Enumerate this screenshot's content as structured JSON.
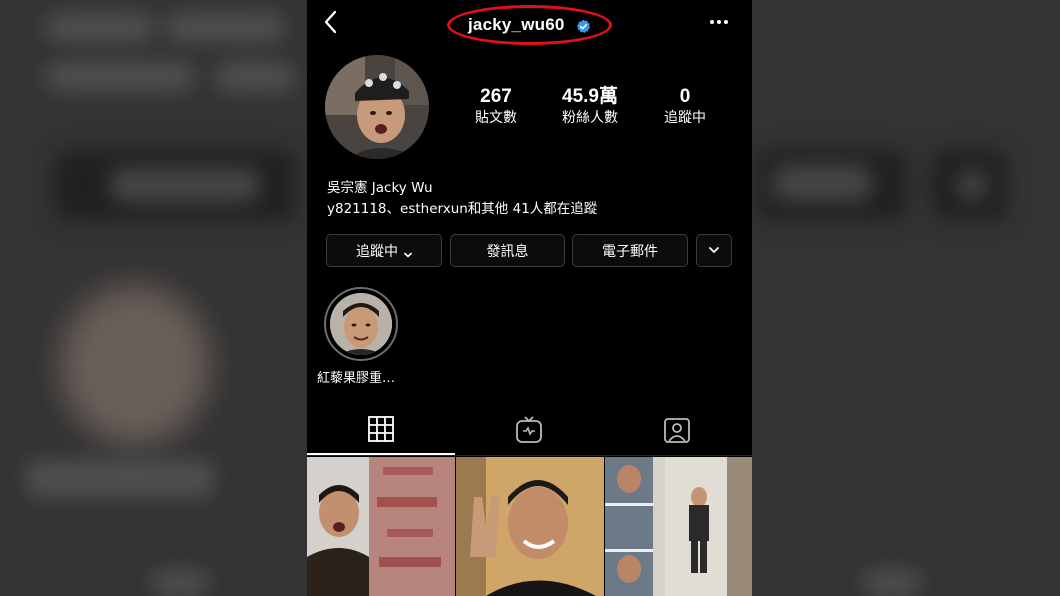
{
  "profile": {
    "username": "jacky_wu60",
    "full_name": "吳宗憲 Jacky Wu",
    "followed_by": "y821118、estherxun和其他 41人都在追蹤"
  },
  "stats": {
    "posts_count": "267",
    "posts_label": "貼文數",
    "followers_count": "45.9萬",
    "followers_label": "粉絲人數",
    "following_count": "0",
    "following_label": "追蹤中"
  },
  "actions": {
    "following_label": "追蹤中",
    "message_label": "發訊息",
    "email_label": "電子郵件"
  },
  "highlights": [
    {
      "label": "紅藜果膠重…"
    }
  ],
  "tabs": [
    {
      "icon": "grid-icon",
      "active": true
    },
    {
      "icon": "igtv-icon",
      "active": false
    },
    {
      "icon": "tagged-icon",
      "active": false
    }
  ],
  "colors": {
    "background": "#000000",
    "verified_badge": "#3897f0",
    "annotation_circle": "#e0101a"
  }
}
